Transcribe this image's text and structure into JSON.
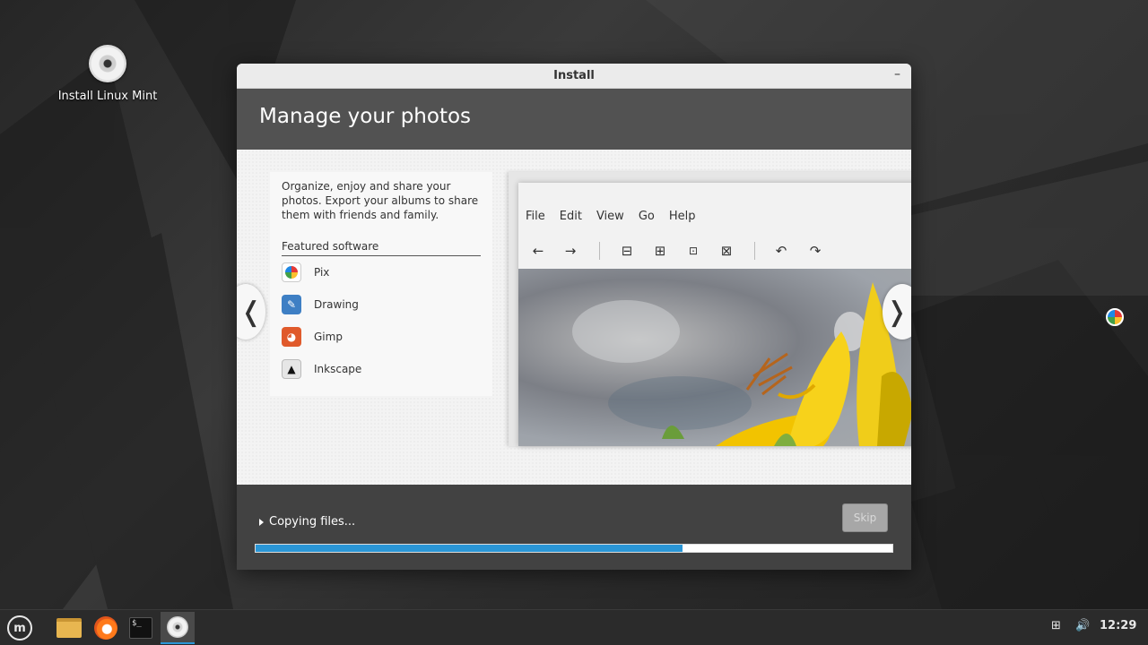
{
  "desktop": {
    "icon_label": "Install Linux Mint"
  },
  "window": {
    "title": "Install",
    "minimize_glyph": "–",
    "header": "Manage your photos",
    "slide": {
      "description": "Organize, enjoy and share your photos. Export your albums to share them with friends and family.",
      "featured_label": "Featured software",
      "software": [
        {
          "name": "Pix",
          "icon": "pix-icon"
        },
        {
          "name": "Drawing",
          "icon": "drawing-icon"
        },
        {
          "name": "Gimp",
          "icon": "gimp-icon"
        },
        {
          "name": "Inkscape",
          "icon": "inkscape-icon"
        }
      ],
      "screenshot_menu": [
        "File",
        "Edit",
        "View",
        "Go",
        "Help"
      ],
      "prev_glyph": "❬",
      "next_glyph": "❭"
    },
    "footer": {
      "status": "Copying files...",
      "skip_label": "Skip",
      "progress": 0.67
    }
  },
  "taskbar": {
    "apps": [
      "menu-icon",
      "files-icon",
      "firefox-icon",
      "terminal-icon",
      "installer-icon"
    ],
    "terminal_glyph": "$_",
    "clock": "12:29"
  },
  "colors": {
    "accent": "#2a96d6",
    "header_bg": "#525252",
    "footer_bg": "#424242"
  }
}
